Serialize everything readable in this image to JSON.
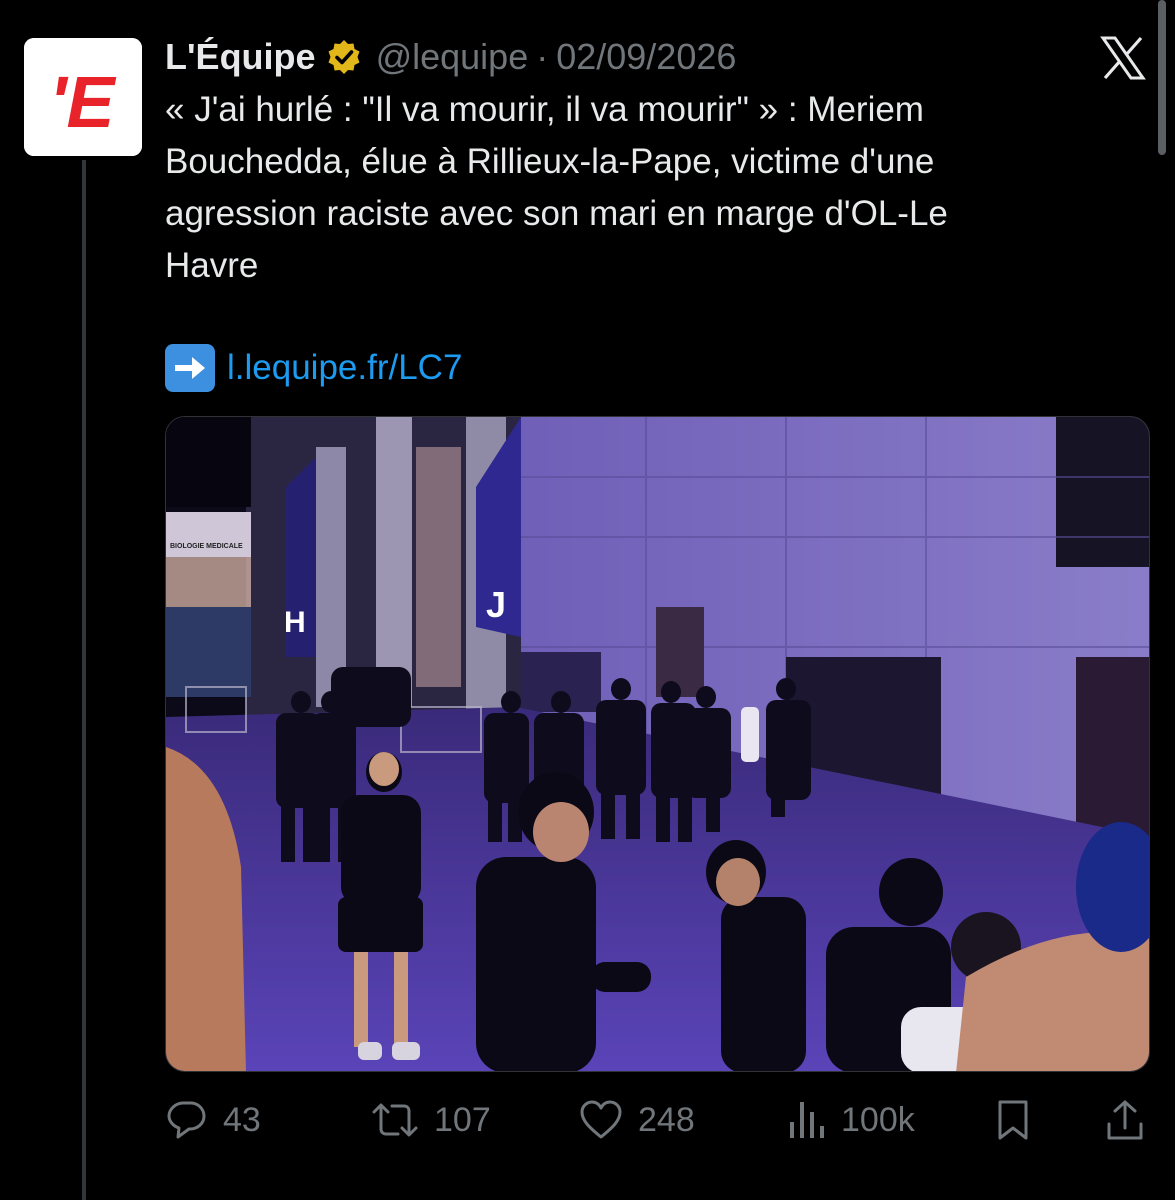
{
  "account": {
    "name": "L'Équipe",
    "handle": "@lequipe",
    "separator": "·",
    "date": "02/09/2026",
    "avatar_icon": "lequipe-logo-icon",
    "avatar_text": "'E",
    "verified_icon": "gold-verified-badge-icon",
    "brand_color": "#e8242a",
    "verified_color": "#e2b719"
  },
  "platform_logo": "x-logo-icon",
  "tweet": {
    "lines": [
      "« J'ai hurlé : \"Il va mourir, il va mourir\" » : Meriem",
      "Bouchedda, élue à Rillieux-la-Pape, victime d'une",
      "agression raciste avec son mari en marge d'OL-Le",
      "Havre"
    ],
    "link_emoji": "right-arrow-emoji-icon",
    "link_text": "l.lequipe.fr/LC7",
    "link_color": "#1d9bf0"
  },
  "media": {
    "signs": {
      "left_sign": "BIOLOGIE MEDICALE",
      "letter_h": "H",
      "letter_j": "J"
    }
  },
  "actions": {
    "replies": {
      "icon": "reply-icon",
      "count": "43"
    },
    "reposts": {
      "icon": "repost-icon",
      "count": "107"
    },
    "likes": {
      "icon": "heart-icon",
      "count": "248"
    },
    "views": {
      "icon": "views-icon",
      "count": "100k"
    },
    "bookmark": {
      "icon": "bookmark-icon"
    },
    "share": {
      "icon": "share-icon"
    }
  }
}
